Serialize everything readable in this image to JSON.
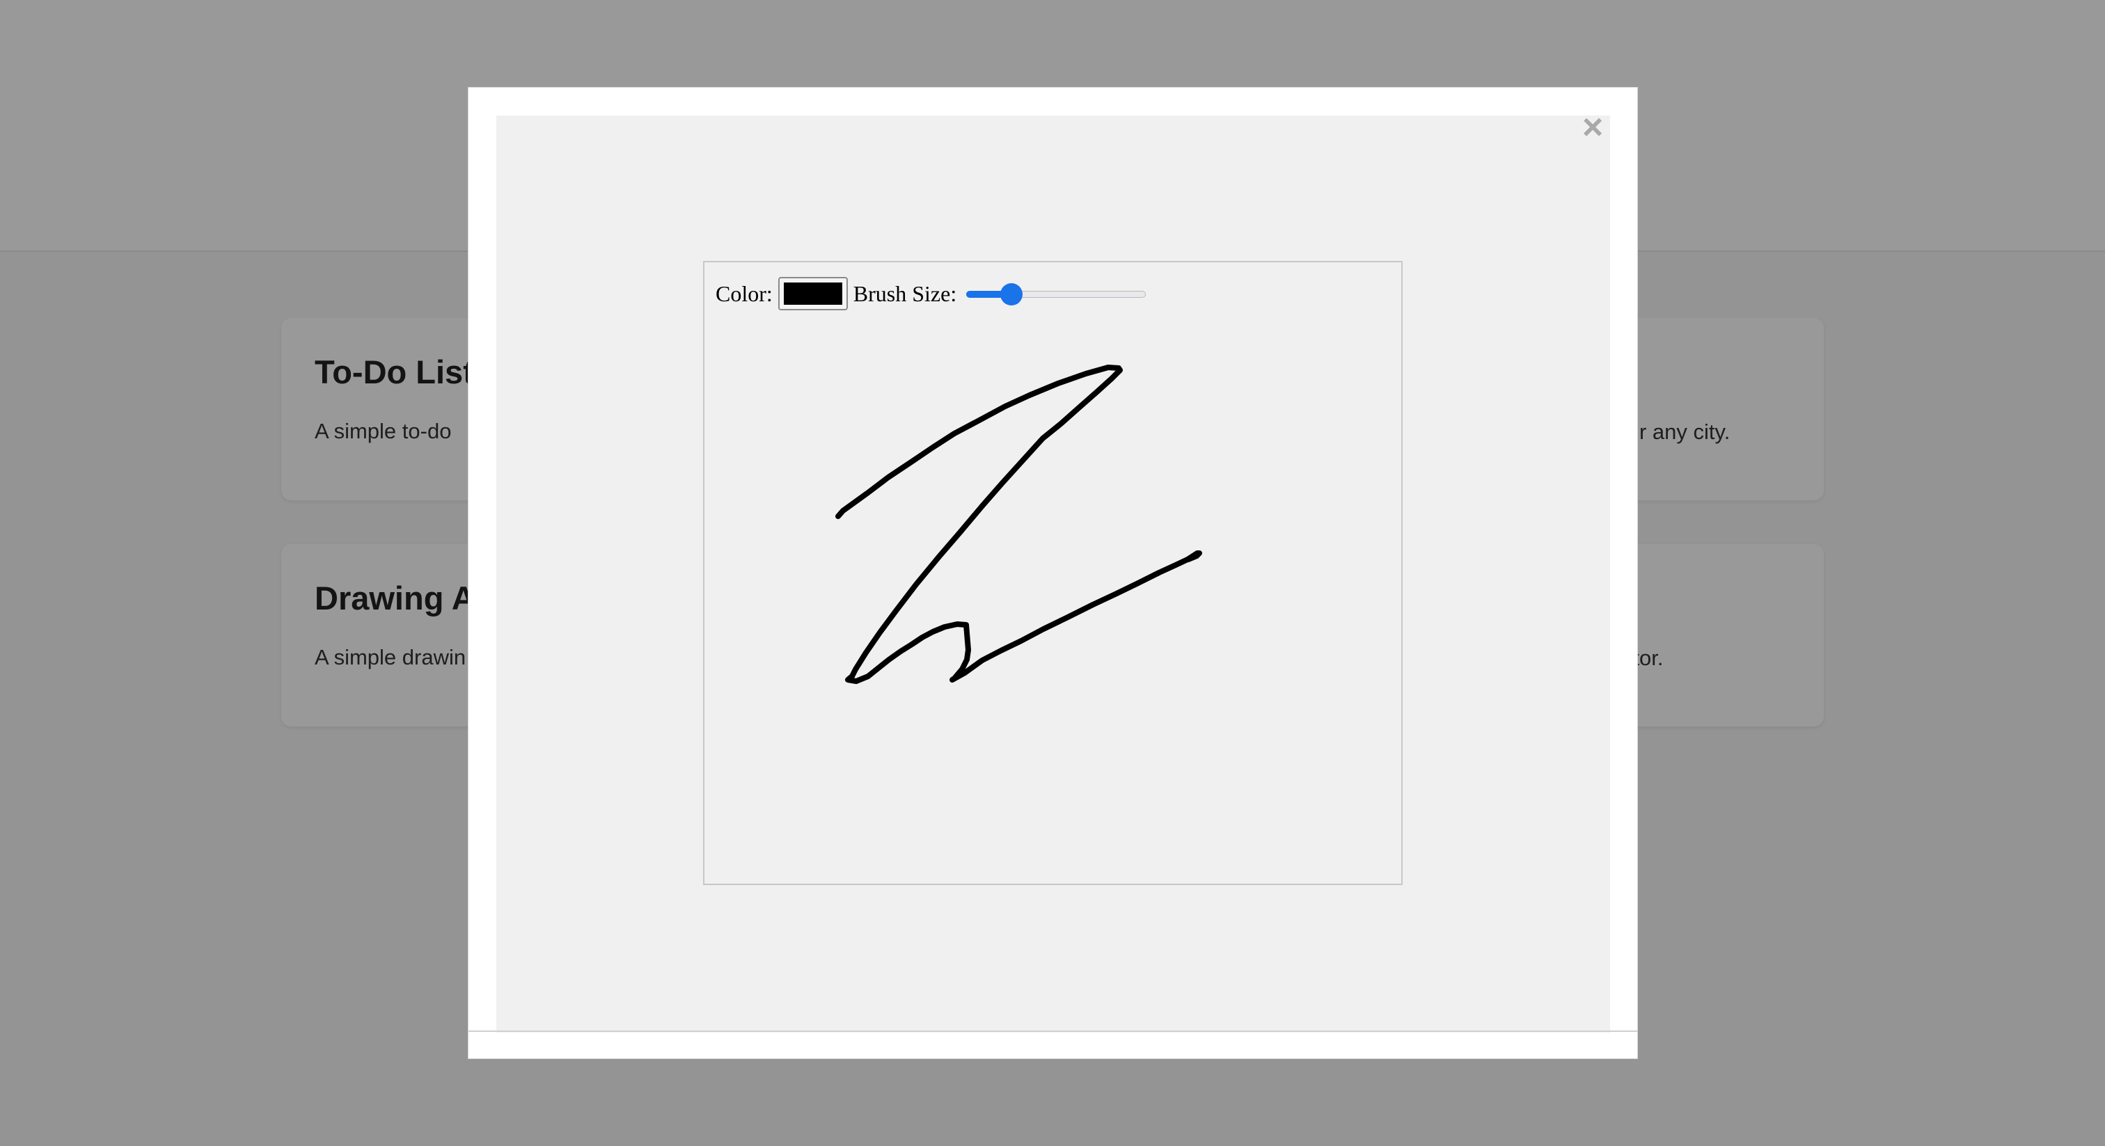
{
  "background": {
    "cards": [
      {
        "title": "To-Do List",
        "description": "A simple to-do"
      },
      {
        "title": "",
        "description": "r any city."
      },
      {
        "title": "Drawing A",
        "description": "A simple drawin"
      },
      {
        "title": "",
        "description": "editor."
      }
    ]
  },
  "modal": {
    "close_glyph": "×",
    "drawing_app": {
      "color_label": "Color:",
      "color_value": "#000000",
      "brush_label": "Brush Size:",
      "brush_size_fraction": 0.25
    }
  }
}
